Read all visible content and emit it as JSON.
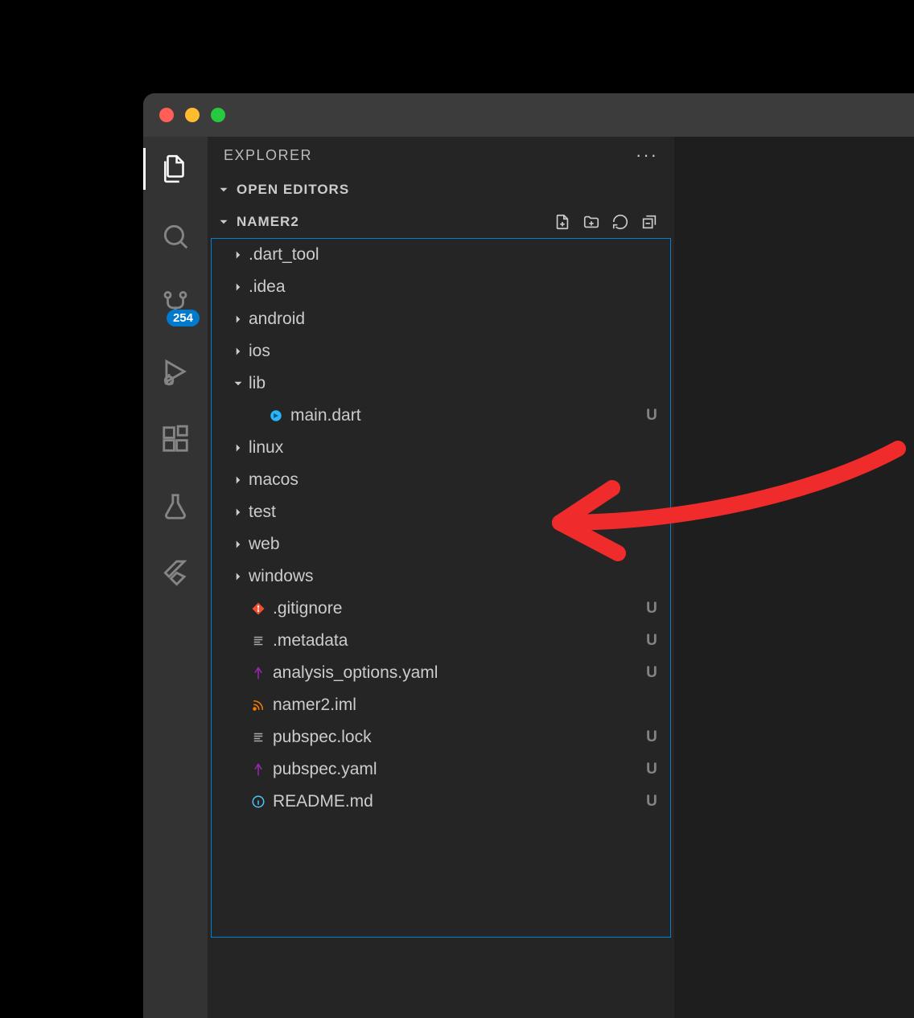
{
  "sidebar": {
    "title": "EXPLORER",
    "sections": {
      "open_editors": {
        "title": "OPEN EDITORS"
      },
      "project": {
        "title": "NAMER2"
      }
    }
  },
  "activity": {
    "badge_count": "254"
  },
  "tree": [
    {
      "type": "folder",
      "name": ".dart_tool",
      "depth": 1,
      "expanded": false,
      "status": ""
    },
    {
      "type": "folder",
      "name": ".idea",
      "depth": 1,
      "expanded": false,
      "status": ""
    },
    {
      "type": "folder",
      "name": "android",
      "depth": 1,
      "expanded": false,
      "status": "dot"
    },
    {
      "type": "folder",
      "name": "ios",
      "depth": 1,
      "expanded": false,
      "status": "dot"
    },
    {
      "type": "folder",
      "name": "lib",
      "depth": 1,
      "expanded": true,
      "status": "dot"
    },
    {
      "type": "file",
      "name": "main.dart",
      "depth": 2,
      "icon": "dart",
      "status": "U"
    },
    {
      "type": "folder",
      "name": "linux",
      "depth": 1,
      "expanded": false,
      "status": "dot"
    },
    {
      "type": "folder",
      "name": "macos",
      "depth": 1,
      "expanded": false,
      "status": "dot"
    },
    {
      "type": "folder",
      "name": "test",
      "depth": 1,
      "expanded": false,
      "status": "dot"
    },
    {
      "type": "folder",
      "name": "web",
      "depth": 1,
      "expanded": false,
      "status": "dot"
    },
    {
      "type": "folder",
      "name": "windows",
      "depth": 1,
      "expanded": false,
      "status": "dot"
    },
    {
      "type": "file",
      "name": ".gitignore",
      "depth": 1,
      "icon": "git",
      "status": "U"
    },
    {
      "type": "file",
      "name": ".metadata",
      "depth": 1,
      "icon": "lines",
      "status": "U"
    },
    {
      "type": "file",
      "name": "analysis_options.yaml",
      "depth": 1,
      "icon": "yaml",
      "status": "U"
    },
    {
      "type": "file",
      "name": "namer2.iml",
      "depth": 1,
      "icon": "rss",
      "status": ""
    },
    {
      "type": "file",
      "name": "pubspec.lock",
      "depth": 1,
      "icon": "lines",
      "status": "U"
    },
    {
      "type": "file",
      "name": "pubspec.yaml",
      "depth": 1,
      "icon": "yaml",
      "status": "U"
    },
    {
      "type": "file",
      "name": "README.md",
      "depth": 1,
      "icon": "info",
      "status": "U"
    }
  ]
}
